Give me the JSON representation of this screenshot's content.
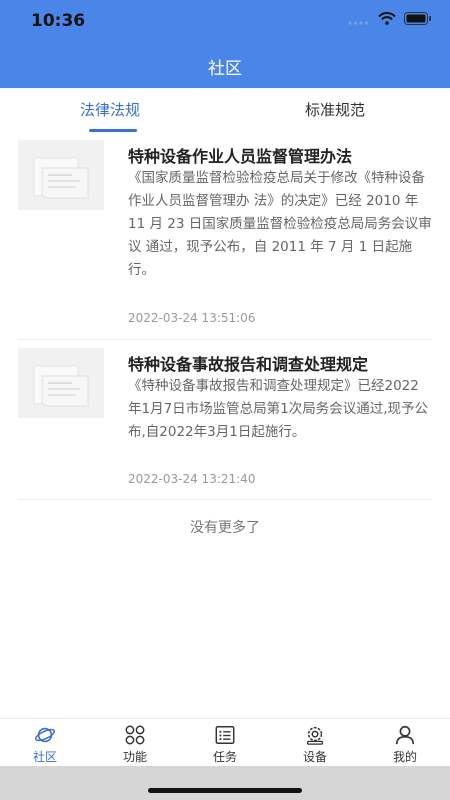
{
  "status_bar": {
    "time": "10:36"
  },
  "header": {
    "title": "社区"
  },
  "tabs": [
    {
      "label": "法律法规",
      "active": true
    },
    {
      "label": "标准规范",
      "active": false
    }
  ],
  "articles": [
    {
      "title": "特种设备作业人员监督管理办法",
      "summary": "《国家质量监督检验检疫总局关于修改《特种设备作业人员监督管理办 法》的决定》已经 2010 年 11 月 23 日国家质量监督检验检疫总局局务会议审议 通过，现予公布，自 2011 年 7 月 1 日起施行。",
      "date": "2022-03-24 13:51:06"
    },
    {
      "title": "特种设备事故报告和调查处理规定",
      "summary": "《特种设备事故报告和调查处理规定》已经2022年1月7日市场监管总局第1次局务会议通过,现予公布,自2022年3月1日起施行。",
      "date": "2022-03-24 13:21:40"
    }
  ],
  "list_footer": "没有更多了",
  "bottom_nav": [
    {
      "label": "社区",
      "icon": "planet-icon",
      "active": true
    },
    {
      "label": "功能",
      "icon": "grid-icon",
      "active": false
    },
    {
      "label": "任务",
      "icon": "task-list-icon",
      "active": false
    },
    {
      "label": "设备",
      "icon": "device-gear-icon",
      "active": false
    },
    {
      "label": "我的",
      "icon": "user-icon",
      "active": false
    }
  ],
  "colors": {
    "brand": "#4a86e8",
    "accent": "#3b6fd1"
  }
}
